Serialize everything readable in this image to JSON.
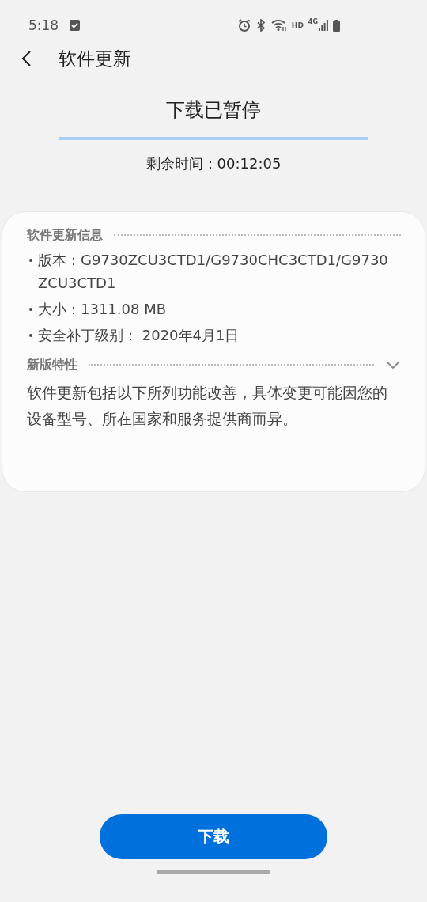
{
  "status_bar": {
    "time": "5:18",
    "hd": "HD",
    "network": "4G"
  },
  "header": {
    "title": "软件更新"
  },
  "download": {
    "status": "下载已暂停",
    "level": 1,
    "remaining": "剩余时间：00:12:05"
  },
  "info": {
    "heading": "软件更新信息",
    "items": [
      "版本：G9730ZCU3CTD1/G9730CHC3CTD1/G9730ZCU3CTD1",
      "大小：1311.08 MB",
      "安全补丁级别： 2020年4月1日"
    ]
  },
  "features": {
    "heading": "新版特性",
    "text": "软件更新包括以下所列功能改善，具体变更可能因您的设备型号、所在国家和服务提供商而异。"
  },
  "button": {
    "label": "下载"
  }
}
